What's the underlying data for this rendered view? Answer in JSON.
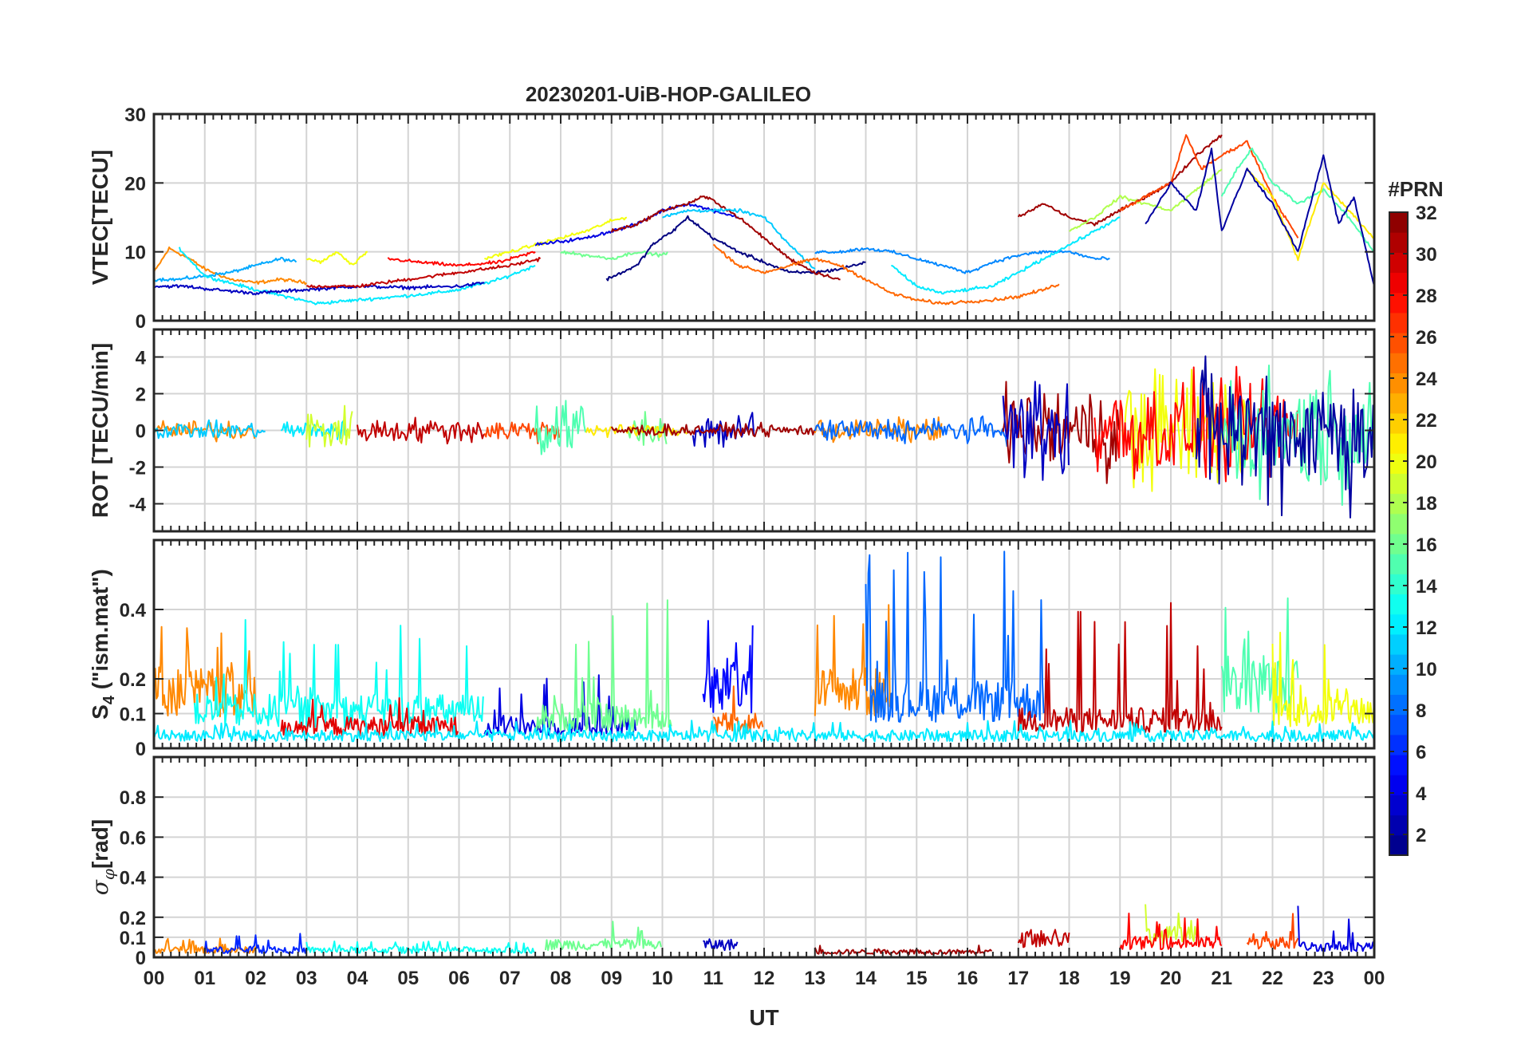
{
  "chart_data": {
    "type": "line",
    "title": "20230201-UiB-HOP-GALILEO",
    "xlabel": "UT",
    "x_ticks": [
      "00",
      "01",
      "02",
      "03",
      "04",
      "05",
      "06",
      "07",
      "08",
      "09",
      "10",
      "11",
      "12",
      "13",
      "14",
      "15",
      "16",
      "17",
      "18",
      "19",
      "20",
      "21",
      "22",
      "23",
      "00"
    ],
    "xlim": [
      0,
      24
    ],
    "grid": true,
    "colorbar": {
      "title": "#PRN",
      "colormap": "jet",
      "range": [
        1,
        32
      ],
      "ticks": [
        "2",
        "4",
        "6",
        "8",
        "10",
        "12",
        "14",
        "16",
        "18",
        "20",
        "22",
        "24",
        "26",
        "28",
        "30",
        "32"
      ]
    },
    "panels": [
      {
        "id": "vtec",
        "ylabel": "VTEC[TECU]",
        "ylim": [
          0,
          30
        ],
        "yticks": [
          "0",
          "10",
          "20",
          "30"
        ],
        "series": [
          {
            "prn": 24,
            "x": [
              0.0,
              0.3,
              0.7,
              1.0,
              1.5,
              2.0,
              2.5,
              3.0
            ],
            "y": [
              7,
              10.5,
              9,
              7.5,
              6,
              5.5,
              6,
              5.5
            ]
          },
          {
            "prn": 10,
            "x": [
              0.0,
              0.5,
              1.0,
              1.5,
              2.0,
              2.5,
              2.8
            ],
            "y": [
              6,
              6,
              6.5,
              7,
              8,
              9,
              8.5
            ]
          },
          {
            "prn": 12,
            "x": [
              0.5,
              1.0,
              1.5,
              2.0,
              2.6,
              3.2,
              4.0,
              4.8,
              5.5,
              6.0,
              6.8,
              7.5
            ],
            "y": [
              10.5,
              6.5,
              5.5,
              4.5,
              3.5,
              2.5,
              3,
              3.5,
              4,
              4.5,
              6,
              8
            ]
          },
          {
            "prn": 3,
            "x": [
              0.0,
              0.6,
              1.2,
              2.0,
              3.0,
              4.0,
              5.0,
              6.0,
              6.5
            ],
            "y": [
              5,
              5,
              4.5,
              4,
              4.5,
              5,
              4.8,
              5,
              5.5
            ]
          },
          {
            "prn": 20,
            "x": [
              3.0,
              3.3,
              3.6,
              3.9,
              4.2
            ],
            "y": [
              9,
              8.5,
              10,
              8,
              10
            ]
          },
          {
            "prn": 28,
            "x": [
              4.6,
              5.2,
              6.0,
              6.8,
              7.5
            ],
            "y": [
              9,
              8.5,
              8,
              8.5,
              10
            ]
          },
          {
            "prn": 30,
            "x": [
              3.0,
              4.0,
              5.0,
              6.0,
              7.0,
              7.6
            ],
            "y": [
              5,
              5,
              6,
              7,
              8,
              9
            ]
          },
          {
            "prn": 20,
            "x": [
              6.5,
              7.5,
              8.5,
              9.0,
              9.3
            ],
            "y": [
              9,
              11,
              13,
              14.5,
              15
            ]
          },
          {
            "prn": 16,
            "x": [
              8.0,
              8.5,
              9.0,
              9.5,
              10.0,
              10.1
            ],
            "y": [
              10,
              9.5,
              9,
              10,
              9.5,
              10
            ]
          },
          {
            "prn": 4,
            "x": [
              7.5,
              8.5,
              9.5,
              10.0,
              10.5,
              11.0,
              11.5
            ],
            "y": [
              11,
              12,
              14,
              16,
              17,
              16,
              15
            ]
          },
          {
            "prn": 1,
            "x": [
              8.9,
              9.2,
              9.5,
              9.8,
              10.2,
              10.5,
              11.0,
              11.5,
              12.0,
              12.5,
              13.0,
              13.5,
              14.0
            ],
            "y": [
              6,
              7,
              8,
              11,
              13,
              15,
              12,
              10,
              8.5,
              7,
              7,
              7.5,
              8.5
            ]
          },
          {
            "prn": 31,
            "x": [
              9.0,
              9.5,
              10.0,
              10.5,
              10.8,
              11.0,
              11.5,
              12.0,
              12.5,
              13.0,
              13.5
            ],
            "y": [
              13,
              14,
              16,
              17,
              18,
              17.5,
              15,
              12,
              9,
              7,
              6
            ]
          },
          {
            "prn": 11,
            "x": [
              10.0,
              10.5,
              11.0,
              11.5,
              12.0,
              12.5,
              13.0
            ],
            "y": [
              15,
              16,
              16,
              16,
              15,
              11,
              7.5
            ]
          },
          {
            "prn": 25,
            "x": [
              11.0,
              11.5,
              12.0,
              12.5,
              13.0,
              13.5,
              14.0,
              14.5,
              15.0,
              15.5,
              16.0,
              16.5,
              17.0,
              17.5,
              17.8
            ],
            "y": [
              11,
              8,
              7,
              8,
              9,
              8,
              6,
              4,
              3,
              2.5,
              2.8,
              3,
              3.5,
              4.5,
              5.3
            ]
          },
          {
            "prn": 9,
            "x": [
              13.0,
              13.5,
              14.0,
              14.5,
              15.0,
              15.5,
              16.0,
              16.5,
              17.0,
              17.5,
              18.0,
              18.5,
              18.8
            ],
            "y": [
              10,
              10,
              10.5,
              10,
              9,
              8,
              7,
              8.5,
              9.5,
              10,
              10,
              9,
              9
            ]
          },
          {
            "prn": 12,
            "x": [
              14.5,
              15.0,
              15.5,
              16.0,
              16.5,
              17.0,
              17.5,
              18.0,
              18.5,
              19.0
            ],
            "y": [
              8,
              5,
              4,
              4.5,
              5,
              7,
              9,
              11,
              13,
              15
            ]
          },
          {
            "prn": 31,
            "x": [
              17.0,
              17.5,
              18.0,
              18.5,
              19.0,
              19.5,
              20.0,
              20.5,
              21.0
            ],
            "y": [
              15,
              17,
              15,
              14,
              16,
              18,
              20,
              24,
              27
            ]
          },
          {
            "prn": 18,
            "x": [
              18.0,
              18.5,
              19.0,
              19.5,
              20.0,
              20.5,
              21.0
            ],
            "y": [
              13,
              15,
              18,
              17,
              16,
              19,
              22
            ]
          },
          {
            "prn": 26,
            "x": [
              19.0,
              19.5,
              20.0,
              20.3,
              20.6,
              21.0,
              21.5,
              22.0,
              22.5
            ],
            "y": [
              16,
              18,
              20,
              27,
              22,
              24,
              26,
              18,
              12
            ]
          },
          {
            "prn": 15,
            "x": [
              21.0,
              21.3,
              21.6,
              22.0,
              22.5,
              23.0,
              23.5,
              24.0
            ],
            "y": [
              18,
              22,
              25,
              20,
              17,
              19,
              15,
              10
            ]
          },
          {
            "prn": 21,
            "x": [
              21.5,
              22.0,
              22.5,
              23.0,
              23.5,
              24.0
            ],
            "y": [
              22,
              18,
              9,
              20,
              16,
              12
            ]
          },
          {
            "prn": 2,
            "x": [
              19.5,
              20.0,
              20.5,
              20.8,
              21.0,
              21.5,
              22.0,
              22.5,
              23.0,
              23.3,
              23.6,
              24.0
            ],
            "y": [
              14,
              20,
              16,
              25,
              13,
              22,
              17,
              10,
              24,
              14,
              18,
              5
            ]
          }
        ]
      },
      {
        "id": "rot",
        "ylabel": "ROT [TECU/min]",
        "ylim": [
          -5.5,
          5.5
        ],
        "yticks": [
          "-4",
          "-2",
          "0",
          "2",
          "4"
        ],
        "series": [
          {
            "prn": 24,
            "segment": [
              0.0,
              2.0
            ],
            "amplitude": 0.5
          },
          {
            "prn": 11,
            "segment": [
              0.0,
              2.2
            ],
            "amplitude": 0.4
          },
          {
            "prn": 12,
            "segment": [
              2.5,
              3.8
            ],
            "amplitude": 0.5
          },
          {
            "prn": 19,
            "segment": [
              3.0,
              3.9
            ],
            "amplitude": 1.2
          },
          {
            "prn": 30,
            "segment": [
              4.0,
              6.5
            ],
            "amplitude": 0.6
          },
          {
            "prn": 26,
            "segment": [
              6.5,
              8.0
            ],
            "amplitude": 0.6
          },
          {
            "prn": 15,
            "segment": [
              7.5,
              8.5
            ],
            "amplitude": 1.5
          },
          {
            "prn": 16,
            "segment": [
              9.3,
              10.1
            ],
            "amplitude": 1.0
          },
          {
            "prn": 21,
            "segment": [
              8.5,
              10.5
            ],
            "amplitude": 0.3
          },
          {
            "prn": 3,
            "segment": [
              10.6,
              11.8
            ],
            "amplitude": 1.0
          },
          {
            "prn": 31,
            "segment": [
              9.0,
              13.0
            ],
            "amplitude": 0.3
          },
          {
            "prn": 24,
            "segment": [
              13.0,
              15.5
            ],
            "amplitude": 0.6
          },
          {
            "prn": 8,
            "segment": [
              13.0,
              16.8
            ],
            "amplitude": 0.6
          },
          {
            "prn": 31,
            "segment": [
              16.7,
              19.0
            ],
            "amplitude": 2.2
          },
          {
            "prn": 3,
            "segment": [
              16.7,
              18.0
            ],
            "amplitude": 2.5
          },
          {
            "prn": 20,
            "segment": [
              19.0,
              21.5
            ],
            "amplitude": 3.0
          },
          {
            "prn": 28,
            "segment": [
              18.5,
              22.5
            ],
            "amplitude": 2.5
          },
          {
            "prn": 15,
            "segment": [
              21.0,
              24.0
            ],
            "amplitude": 3.0
          },
          {
            "prn": 2,
            "segment": [
              20.5,
              24.0
            ],
            "amplitude": 3.5
          }
        ]
      },
      {
        "id": "s4",
        "ylabel": "S4 (\"ism.mat\")",
        "ylim": [
          0,
          0.6
        ],
        "yticks": [
          "0",
          "0.1",
          "0.2",
          "0.4"
        ],
        "series": [
          {
            "prn": 24,
            "segment": [
              0.0,
              2.0
            ],
            "level": 0.18,
            "peak": 0.37
          },
          {
            "prn": 13,
            "segment": [
              0.8,
              6.5
            ],
            "level": 0.12,
            "peak": 0.38
          },
          {
            "prn": 29,
            "segment": [
              2.5,
              6.0
            ],
            "level": 0.07,
            "peak": 0.15
          },
          {
            "prn": 4,
            "segment": [
              6.5,
              9.5
            ],
            "level": 0.07,
            "peak": 0.28
          },
          {
            "prn": 16,
            "segment": [
              7.5,
              10.2
            ],
            "level": 0.1,
            "peak": 0.43
          },
          {
            "prn": 5,
            "segment": [
              10.8,
              11.8
            ],
            "level": 0.2,
            "peak": 0.38
          },
          {
            "prn": 25,
            "segment": [
              11.0,
              12.0
            ],
            "level": 0.08,
            "peak": 0.2
          },
          {
            "prn": 24,
            "segment": [
              13.0,
              14.5
            ],
            "level": 0.18,
            "peak": 0.43
          },
          {
            "prn": 8,
            "segment": [
              14.0,
              17.5
            ],
            "level": 0.15,
            "peak": 0.58
          },
          {
            "prn": 30,
            "segment": [
              17.0,
              21.0
            ],
            "level": 0.09,
            "peak": 0.43
          },
          {
            "prn": 15,
            "segment": [
              21.0,
              22.5
            ],
            "level": 0.2,
            "peak": 0.48
          },
          {
            "prn": 20,
            "segment": [
              22.0,
              24.0
            ],
            "level": 0.12,
            "peak": 0.38
          },
          {
            "prn": 12,
            "segment": [
              0.0,
              24.0
            ],
            "level": 0.04,
            "peak": 0.08
          }
        ]
      },
      {
        "id": "sigma_phi",
        "ylabel": "σφ[rad]",
        "ylim": [
          0,
          1.0
        ],
        "yticks": [
          "0",
          "0.1",
          "0.2",
          "0.4",
          "0.6",
          "0.8"
        ],
        "series": [
          {
            "prn": 24,
            "segment": [
              0.0,
              2.0
            ],
            "level": 0.04,
            "peak": 0.1
          },
          {
            "prn": 6,
            "segment": [
              1.0,
              3.0
            ],
            "level": 0.04,
            "peak": 0.13
          },
          {
            "prn": 13,
            "segment": [
              3.0,
              7.5
            ],
            "level": 0.04,
            "peak": 0.08
          },
          {
            "prn": 16,
            "segment": [
              7.7,
              10.0
            ],
            "level": 0.07,
            "peak": 0.2
          },
          {
            "prn": 3,
            "segment": [
              10.8,
              11.5
            ],
            "level": 0.07,
            "peak": 0.2
          },
          {
            "prn": 31,
            "segment": [
              13.0,
              16.5
            ],
            "level": 0.03,
            "peak": 0.06
          },
          {
            "prn": 30,
            "segment": [
              17.0,
              18.0
            ],
            "level": 0.1,
            "peak": 0.17
          },
          {
            "prn": 19,
            "segment": [
              19.5,
              20.5
            ],
            "level": 0.12,
            "peak": 0.3
          },
          {
            "prn": 28,
            "segment": [
              19.0,
              21.0
            ],
            "level": 0.08,
            "peak": 0.22
          },
          {
            "prn": 26,
            "segment": [
              21.5,
              22.5
            ],
            "level": 0.08,
            "peak": 0.28
          },
          {
            "prn": 4,
            "segment": [
              22.5,
              24.0
            ],
            "level": 0.06,
            "peak": 0.27
          }
        ]
      }
    ]
  }
}
